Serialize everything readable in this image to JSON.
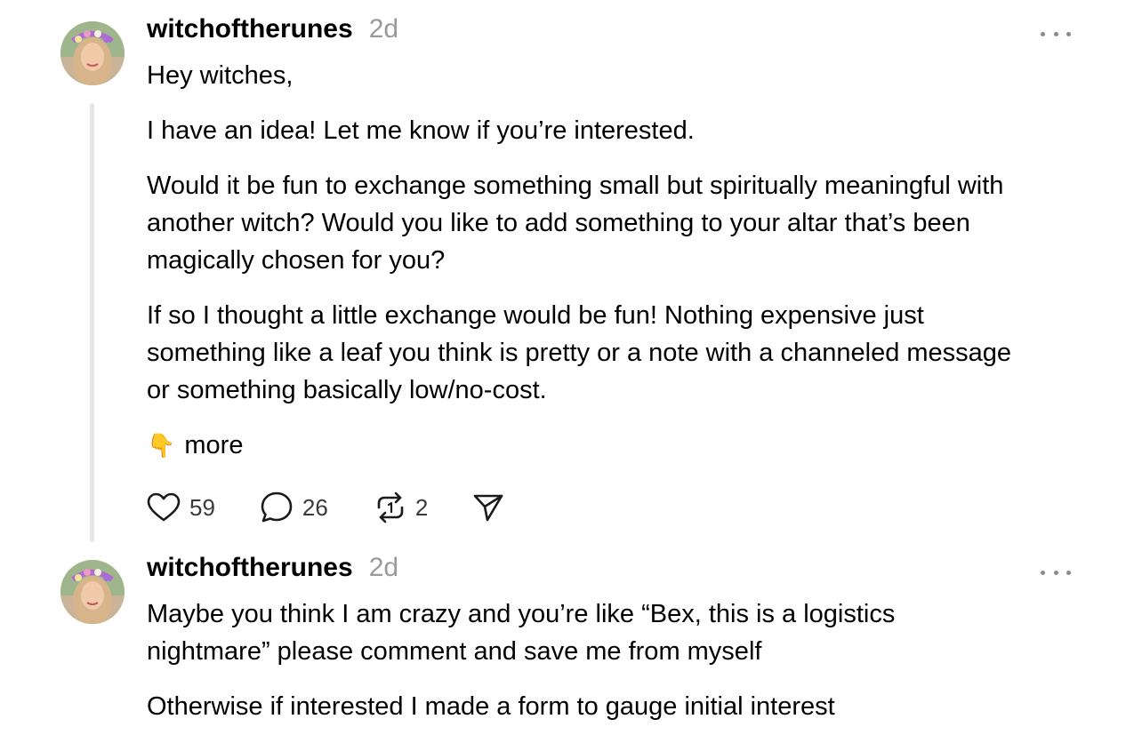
{
  "posts": [
    {
      "author": "witchoftherunes",
      "time": "2d",
      "avatar_icon": "profile-photo-flower-crown",
      "paragraphs": [
        "Hey witches,",
        "I have an idea! Let me know if you’re interested.",
        "Would it be fun to exchange something small but spiritually meaningful with",
        "another witch? Would you like to add something to your altar that’s been",
        "magically chosen for you?",
        "If so I thought a little exchange would be fun! Nothing expensive just",
        "something like a leaf you think is pretty or a note with a channeled message",
        "or something basically low/no-cost."
      ],
      "more_emoji": "👇",
      "more_label": "more",
      "likes": "59",
      "comments": "26",
      "reposts": "2"
    },
    {
      "author": "witchoftherunes",
      "time": "2d",
      "avatar_icon": "profile-photo-flower-crown",
      "paragraphs": [
        "Maybe you think I am crazy and you’re like “Bex, this is a logistics",
        "nightmare” please comment and save me from myself",
        "Otherwise if interested I made a form to gauge initial interest"
      ]
    }
  ],
  "icons": {
    "like": "heart-icon",
    "comment": "comment-bubble-icon",
    "repost": "repost-icon",
    "share": "send-icon",
    "menu": "more-options-icon"
  },
  "colors": {
    "text": "#000000",
    "muted": "#9a9a9a",
    "thread_line": "#e5e5e5",
    "icon": "#1a1a1a"
  }
}
